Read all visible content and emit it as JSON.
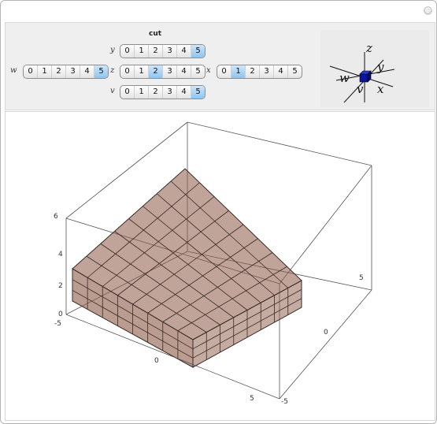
{
  "window": {
    "close_glyph": "⊕"
  },
  "controls": {
    "title": "cut",
    "setter_values": [
      "0",
      "1",
      "2",
      "3",
      "4",
      "5"
    ],
    "bars": [
      {
        "label": "w",
        "selected": 5
      },
      {
        "label": "y",
        "selected": 5
      },
      {
        "label": "z",
        "selected": 2
      },
      {
        "label": "v",
        "selected": 5
      },
      {
        "label": "x",
        "selected": 1
      }
    ]
  },
  "axis_diagram": {
    "labels": [
      "z",
      "y",
      "w",
      "v",
      "x"
    ],
    "cube_color": "#0a14a0"
  },
  "plot": {
    "vertical_axis_ticks": [
      "6",
      "4",
      "2",
      "0"
    ],
    "left_axis_ticks": [
      "-5",
      "0",
      "5"
    ],
    "right_axis_ticks": [
      "5",
      "0",
      "-5"
    ],
    "block_color": "#8c5a46",
    "edge_color": "#3a2a24"
  }
}
